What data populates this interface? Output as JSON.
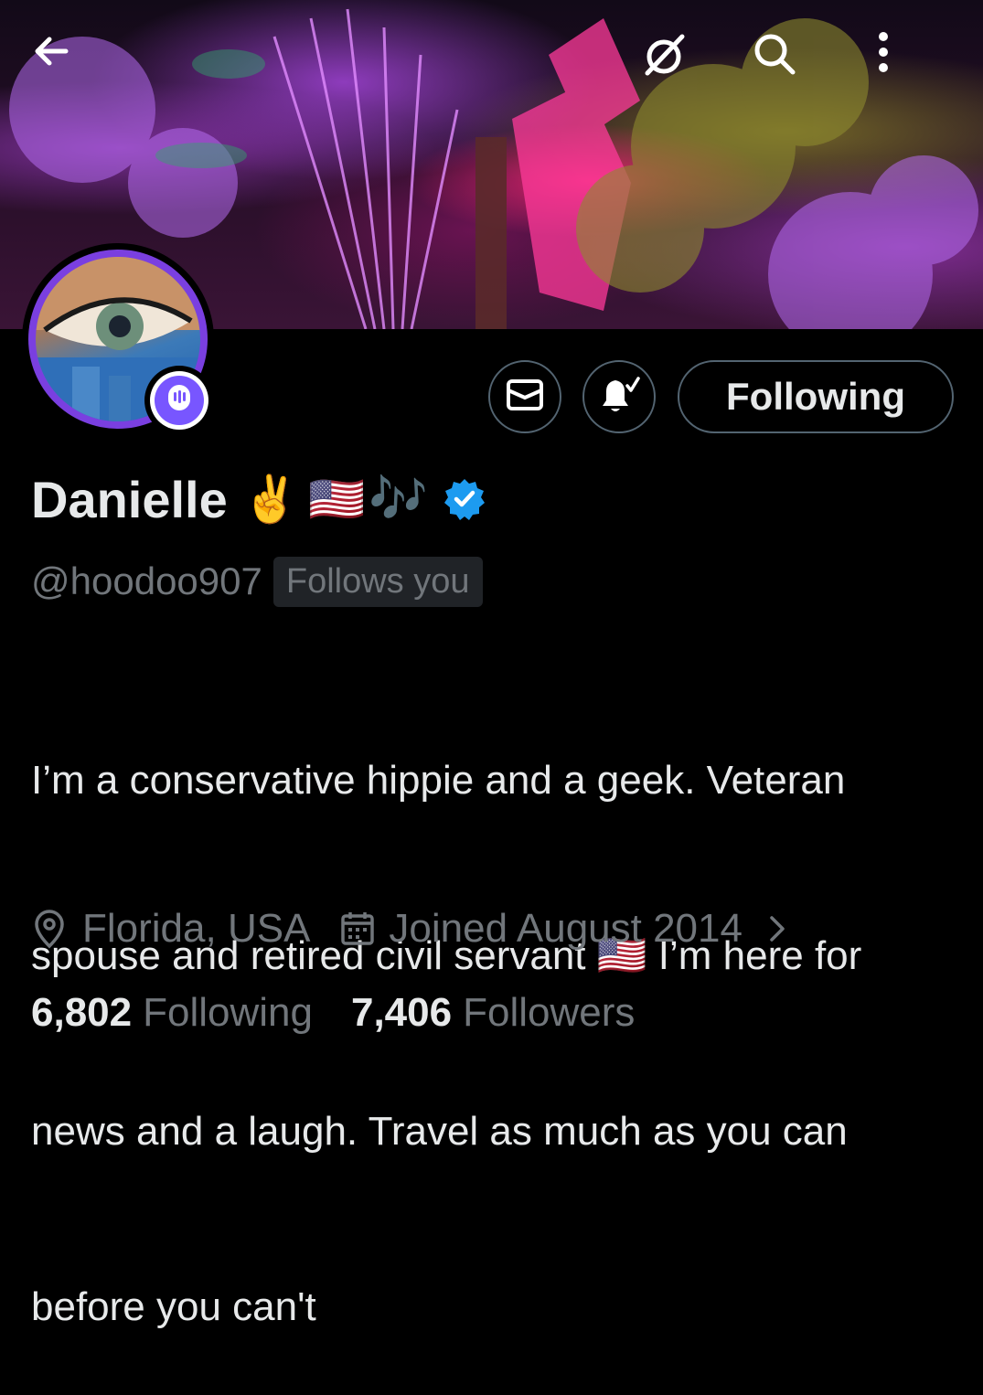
{
  "header": {
    "back_icon": "arrow-left-icon",
    "grok_icon": "grok-icon",
    "search_icon": "search-icon",
    "more_icon": "more-vertical-icon"
  },
  "profile": {
    "display_name": "Danielle",
    "name_emojis": [
      "✌️",
      "🇺🇸",
      "🎶"
    ],
    "verified": true,
    "handle": "@hoodoo907",
    "follows_you_label": "Follows you",
    "spaces_badge_icon": "spaces-icon"
  },
  "actions": {
    "message_icon": "envelope-icon",
    "notify_icon": "bell-check-icon",
    "follow_label": "Following"
  },
  "bio": {
    "line1": "I’m a conservative hippie and a geek. Veteran",
    "line2_a": "spouse and retired civil servant",
    "line2_flag": "🇺🇸",
    "line2_b": " I’m here for",
    "line3": "news and a laugh. Travel as much as you can",
    "line4": "before you can't"
  },
  "meta": {
    "location": "Florida, USA",
    "joined": "Joined August 2014"
  },
  "stats": {
    "following_count": "6,802",
    "following_label": "Following",
    "followers_count": "7,406",
    "followers_label": "Followers"
  },
  "colors": {
    "background": "#000000",
    "text_primary": "#e7e9ea",
    "text_secondary": "#71767b",
    "border": "#536471",
    "verified_blue": "#1d9bf0",
    "spaces_purple": "#7856ff"
  }
}
